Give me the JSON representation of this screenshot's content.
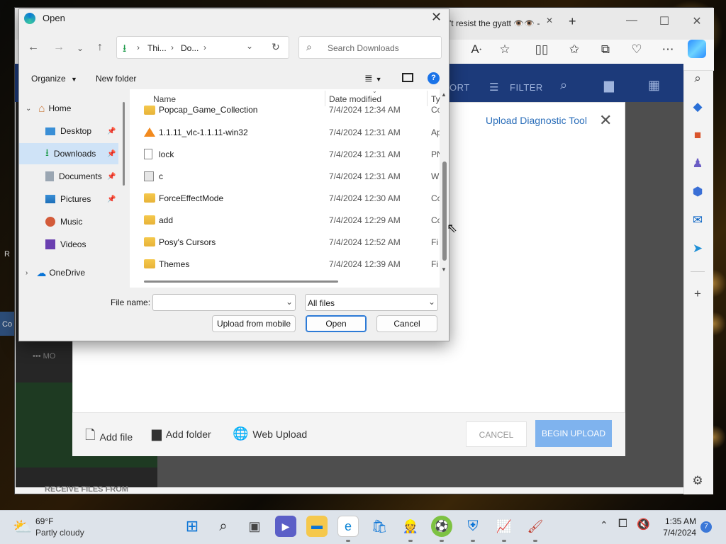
{
  "browser": {
    "tab_title": "'t resist the gyatt 👁️👁️ - \\",
    "window_controls": {
      "minimize": "—",
      "maximize": "☐",
      "close": "✕"
    },
    "new_tab": "+"
  },
  "webpage": {
    "nav_sort": "ORT",
    "nav_filter": "FILTER",
    "upload_tool_title": "Upload Diagnostic Tool",
    "left_more": "•••  MO",
    "left_receive": "RECEIVE FILES FROM",
    "left_edge_R": "R",
    "left_edge_Co": "Co",
    "footer": {
      "add_file": "Add file",
      "add_folder": "Add folder",
      "web_upload": "Web Upload",
      "cancel": "CANCEL",
      "begin_upload": "BEGIN UPLOAD"
    }
  },
  "dialog": {
    "title": "Open",
    "breadcrumb": [
      "Thi...",
      "Do..."
    ],
    "search_placeholder": "Search Downloads",
    "organize": "Organize",
    "new_folder": "New folder",
    "nav_items": [
      {
        "label": "Home",
        "icon": "home-icon"
      },
      {
        "label": "Desktop",
        "icon": "desktop-icon"
      },
      {
        "label": "Downloads",
        "icon": "downloads-icon"
      },
      {
        "label": "Documents",
        "icon": "documents-icon"
      },
      {
        "label": "Pictures",
        "icon": "pictures-icon"
      },
      {
        "label": "Music",
        "icon": "music-icon"
      },
      {
        "label": "Videos",
        "icon": "videos-icon"
      },
      {
        "label": "OneDrive",
        "icon": "onedrive-icon"
      }
    ],
    "columns": {
      "name": "Name",
      "date": "Date modified",
      "type": "Ty"
    },
    "files": [
      {
        "name": "Popcap_Game_Collection",
        "date": "7/4/2024 12:34 AM",
        "type": "Co",
        "icon": "folder-icon"
      },
      {
        "name": "1.1.11_vlc-1.1.11-win32",
        "date": "7/4/2024 12:31 AM",
        "type": "Ap",
        "icon": "vlc-icon"
      },
      {
        "name": "lock",
        "date": "7/4/2024 12:31 AM",
        "type": "PN",
        "icon": "image-file-icon"
      },
      {
        "name": "c",
        "date": "7/4/2024 12:31 AM",
        "type": "W",
        "icon": "system-file-icon"
      },
      {
        "name": "ForceEffectMode",
        "date": "7/4/2024 12:30 AM",
        "type": "Co",
        "icon": "folder-icon"
      },
      {
        "name": "add",
        "date": "7/4/2024 12:29 AM",
        "type": "Co",
        "icon": "folder-icon"
      },
      {
        "name": "Posy's Cursors",
        "date": "7/4/2024 12:52 AM",
        "type": "Fi",
        "icon": "folder-icon"
      },
      {
        "name": "Themes",
        "date": "7/4/2024 12:39 AM",
        "type": "Fi",
        "icon": "folder-icon"
      }
    ],
    "file_name_label": "File name:",
    "file_name_value": "",
    "filter_value": "All files",
    "upload_mobile": "Upload from mobile",
    "open": "Open",
    "cancel": "Cancel"
  },
  "taskbar": {
    "temperature": "69°F",
    "weather": "Partly cloudy",
    "time": "1:35 AM",
    "date": "7/4/2024",
    "notification_count": "7"
  },
  "colors": {
    "accent": "#0067c0",
    "web_nav": "#1c3a7a",
    "begin_upload": "#7fb3ee"
  }
}
